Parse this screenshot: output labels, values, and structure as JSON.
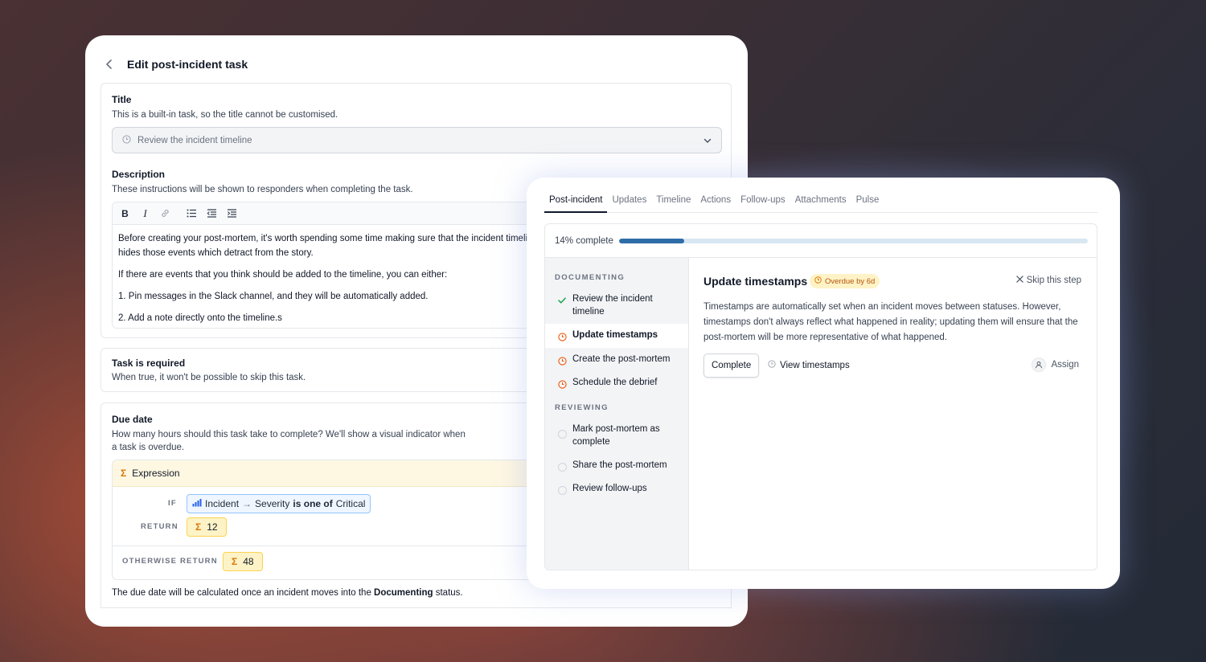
{
  "edit_task": {
    "title": "Edit post-incident task",
    "title_section": {
      "label": "Title",
      "hint": "This is a built-in task, so the title cannot be customised.",
      "select_value": "Review the incident timeline"
    },
    "description_section": {
      "label": "Description",
      "hint": "These instructions will be shown to responders when completing the task.",
      "paragraphs": [
        "Before creating your post-mortem, it's worth spending some time making sure that the incident timeline",
        "hides those events which detract from the story.",
        "If there are events that you think should be added to the timeline, you can either:",
        "1. Pin messages in the Slack channel, and they will be automatically added.",
        "2. Add a note directly onto the timeline.s"
      ]
    },
    "required_section": {
      "label": "Task is required",
      "hint": "When true, it won't be possible to skip this task."
    },
    "due_date_section": {
      "label": "Due date",
      "hint_line1": "How many hours should this task take to complete? We'll show a visual indicator when",
      "hint_line2": "a task is overdue.",
      "expression_label": "Expression",
      "if_keyword": "IF",
      "condition_subject": "Incident",
      "condition_arrow": "→",
      "condition_field": "Severity",
      "condition_operator": "is one of",
      "condition_value": "Critical",
      "return_keyword": "RETURN",
      "return_value": "12",
      "otherwise_keyword": "OTHERWISE RETURN",
      "otherwise_value": "48",
      "footer_prefix": "The due date will be calculated once an incident moves into the",
      "footer_status": "Documenting",
      "footer_suffix": "status."
    }
  },
  "incident": {
    "tabs": [
      {
        "label": "Post-incident",
        "active": true
      },
      {
        "label": "Updates",
        "active": false
      },
      {
        "label": "Timeline",
        "active": false
      },
      {
        "label": "Actions",
        "active": false
      },
      {
        "label": "Follow-ups",
        "active": false
      },
      {
        "label": "Attachments",
        "active": false
      },
      {
        "label": "Pulse",
        "active": false
      }
    ],
    "progress_label": "14% complete",
    "progress_fraction": 0.14,
    "groups": {
      "documenting": "DOCUMENTING",
      "reviewing": "REVIEWING"
    },
    "steps": [
      {
        "label": "Review the incident timeline",
        "state": "done"
      },
      {
        "label": "Update timestamps",
        "state": "overdue-active"
      },
      {
        "label": "Create the post-mortem",
        "state": "overdue"
      },
      {
        "label": "Schedule the debrief",
        "state": "overdue"
      },
      {
        "label": "Mark post-mortem as complete",
        "state": "todo"
      },
      {
        "label": "Share the post-mortem",
        "state": "todo"
      },
      {
        "label": "Review follow-ups",
        "state": "todo"
      }
    ],
    "detail": {
      "title": "Update timestamps",
      "overdue_badge": "Overdue by 6d",
      "skip_label": "Skip this step",
      "description": "Timestamps are automatically set when an incident moves between statuses. However, timestamps don't always reflect what happened in reality; updating them will ensure that the post-mortem will be more representative of what happened.",
      "complete_button": "Complete",
      "view_link": "View timestamps",
      "assign_label": "Assign"
    },
    "colors": {
      "progress_fill": "#2f6da8",
      "progress_track": "#d8e7f2",
      "overdue": "#ea580c",
      "done": "#16a34a",
      "badge_bg": "#fef3c7",
      "badge_text": "#b45309"
    }
  }
}
